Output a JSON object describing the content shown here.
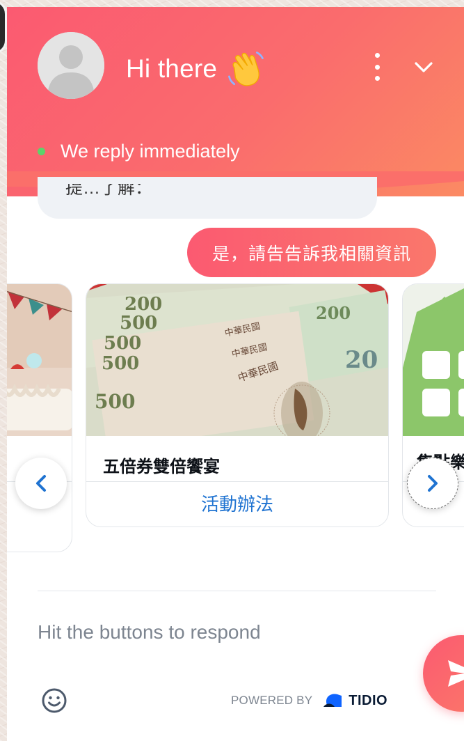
{
  "header": {
    "greeting": "Hi there",
    "status_text": "We reply immediately"
  },
  "conversation": {
    "previous_message_fragment": "提…了解：",
    "user_reply": "是，請告告訴我相關資訊"
  },
  "carousel": {
    "cards": [
      {
        "title": "",
        "action": ""
      },
      {
        "title": "五倍券雙倍饗宴",
        "action": "活動辦法"
      },
      {
        "title": "集點樂",
        "action": ""
      }
    ]
  },
  "banknote_labels": [
    "200",
    "500",
    "500",
    "500",
    "500",
    "200",
    "20",
    "中華民國"
  ],
  "footer": {
    "input_placeholder": "Hit the buttons to respond",
    "powered_by": "POWERED BY",
    "brand": "TIDIO"
  },
  "colors": {
    "header_start": "#fb5a71",
    "header_end": "#fb8a63",
    "status_dot": "#5cd36a",
    "link_blue": "#1f73d1",
    "nav_chevron": "#1f73d1"
  },
  "icons": {
    "avatar": "user-avatar-icon",
    "wave": "waving-hand-icon",
    "menu": "more-vertical-icon",
    "collapse": "chevron-down-icon",
    "prev": "chevron-left-icon",
    "next": "chevron-right-icon",
    "send": "send-icon",
    "emoji": "smiley-icon",
    "brand": "tidio-logo-icon"
  }
}
